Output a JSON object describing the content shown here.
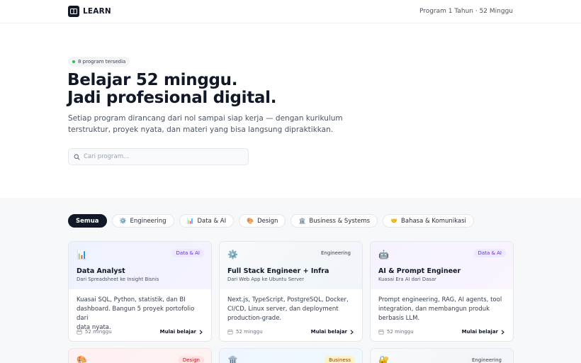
{
  "header": {
    "brand": "LEARN",
    "program_info": "Program 1 Tahun · 52 Minggu"
  },
  "hero": {
    "available": "8 program tersedia",
    "title_line1": "Belajar 52 minggu.",
    "title_line2": "Jadi profesional digital.",
    "subtitle_line1": "Setiap program dirancang dari nol sampai siap kerja — dengan kurikulum",
    "subtitle_line2": "terstruktur, proyek nyata, dan materi yang bisa langsung dipraktikkan.",
    "search_placeholder": "Cari program..."
  },
  "filters": [
    {
      "label": "Semua",
      "emoji": ""
    },
    {
      "label": "Engineering",
      "emoji": "⚙️"
    },
    {
      "label": "Data & AI",
      "emoji": "📊"
    },
    {
      "label": "Design",
      "emoji": "🎨"
    },
    {
      "label": "Business & Systems",
      "emoji": "🏛️"
    },
    {
      "label": "Bahasa & Komunikasi",
      "emoji": "🤝"
    }
  ],
  "cards": [
    {
      "emoji": "📊",
      "badge": "Data & AI",
      "title": "Data Analyst",
      "subtitle": "Dari Spreadsheet ke Insight Bisnis",
      "desc_line1": "Kuasai SQL, Python, statistik, dan BI",
      "desc_line2": "dashboard. Bangun 5 proyek portofolio dari",
      "desc_line3": "data nyata.",
      "duration": "52 minggu",
      "cta": "Mulai belajar"
    },
    {
      "emoji": "⚙️",
      "badge": "Engineering",
      "title": "Full Stack Engineer + Infra",
      "subtitle": "Dari Web App ke Ubuntu Server",
      "desc_line1": "Next.js, TypeScript, PostgreSQL, Docker,",
      "desc_line2": "CI/CD, Linux server, dan deployment",
      "desc_line3": "production-grade.",
      "duration": "52 minggu",
      "cta": "Mulai belajar"
    },
    {
      "emoji": "🤖",
      "badge": "Data & AI",
      "title": "AI & Prompt Engineer",
      "subtitle": "Kuasai Era AI dari Dasar",
      "desc_line1": "Prompt engineering, RAG, AI agents, tool",
      "desc_line2": "integration, dan membangun produk",
      "desc_line3": "berbasis LLM.",
      "duration": "52 minggu",
      "cta": "Mulai belajar"
    }
  ],
  "cards_row2": [
    {
      "emoji": "🎨",
      "badge": "Design"
    },
    {
      "emoji": "🏛️",
      "badge": "Business"
    },
    {
      "emoji": "🔐",
      "badge": "Engineering"
    }
  ],
  "colors": {
    "dark": "#111827",
    "data_ai_badge_bg": "#ede9fe",
    "data_ai_badge_text": "#6d28d9",
    "engineering_badge_bg": "#f3f4f6",
    "engineering_badge_text": "#374151",
    "design_badge_bg": "#fee2e2",
    "business_badge_bg": "#fef3c7"
  }
}
